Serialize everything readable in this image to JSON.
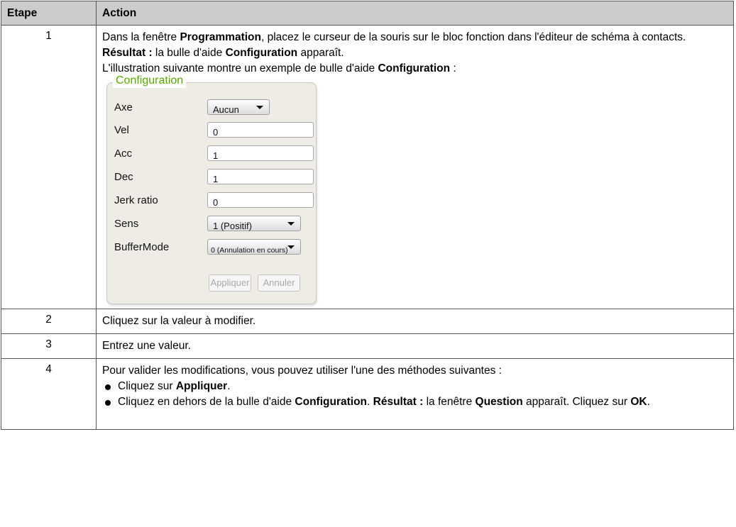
{
  "table": {
    "header": {
      "col1": "Etape",
      "col2": "Action"
    },
    "rows": {
      "r1": {
        "num": "1",
        "line1_pre": "Dans la fenêtre ",
        "line1_bold": "Programmation",
        "line1_post": ", placez le curseur de la souris sur le bloc fonction dans l'éditeur de schéma à contacts.",
        "result_label": "Résultat :",
        "result_pre": " la bulle d'aide ",
        "result_bold": "Configuration",
        "result_post": " apparaît.",
        "illus_pre": "L'illustration suivante montre un exemple de bulle d'aide ",
        "illus_bold": "Configuration",
        "illus_post": " :"
      },
      "r2": {
        "num": "2",
        "text": "Cliquez sur la valeur à modifier."
      },
      "r3": {
        "num": "3",
        "text": "Entrez une valeur."
      },
      "r4": {
        "num": "4",
        "intro": "Pour valider les modifications, vous pouvez utiliser l'une des méthodes suivantes :",
        "m1_pre": "Cliquez sur ",
        "m1_bold": "Appliquer",
        "m1_post": ".",
        "m2_pre": "Cliquez en dehors de la bulle d'aide ",
        "m2_bold1": "Configuration",
        "m2_mid1": ". ",
        "m2_bold2": "Résultat :",
        "m2_mid2": " la fenêtre ",
        "m2_bold3": "Question",
        "m2_mid3": " apparaît. Cliquez sur ",
        "m2_bold4": "OK",
        "m2_post": "."
      }
    }
  },
  "config": {
    "title": "Configuration",
    "axe": {
      "label": "Axe",
      "value": "Aucun"
    },
    "vel": {
      "label": "Vel",
      "value": "0"
    },
    "acc": {
      "label": "Acc",
      "value": "1"
    },
    "dec": {
      "label": "Dec",
      "value": "1"
    },
    "jerk": {
      "label": "Jerk ratio",
      "value": "0"
    },
    "sens": {
      "label": "Sens",
      "value": "1 (Positif)"
    },
    "buffer": {
      "label": "BufferMode",
      "value": "0 (Annulation en cours)"
    },
    "apply_label": "Appliquer",
    "cancel_label": "Annuler"
  }
}
